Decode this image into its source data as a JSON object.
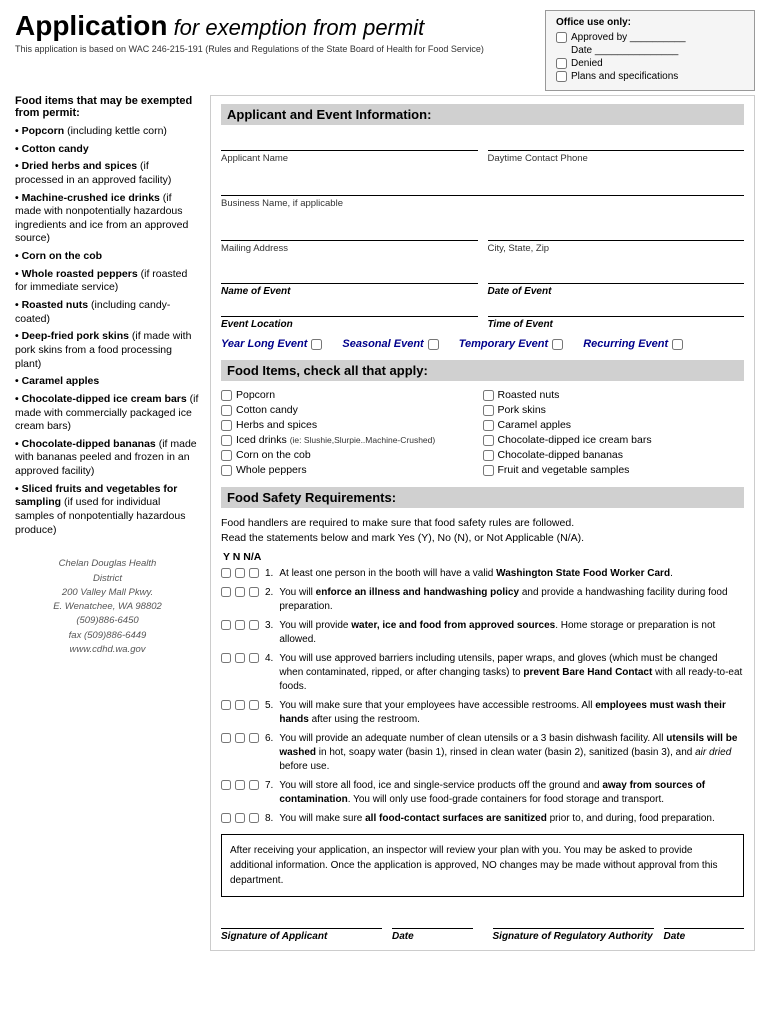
{
  "header": {
    "title_bold": "Application",
    "title_italic": " for exemption from permit",
    "subtitle": "This application is based on WAC 246-215-191 (Rules and Regulations of the State Board of Health for Food Service)"
  },
  "office_box": {
    "title": "Office use only:",
    "approved_by": "Approved by __________",
    "date": "Date _______________",
    "denied": "Denied",
    "plans": "Plans and specifications"
  },
  "sidebar": {
    "title": "Food items that may be exempted from permit:",
    "items": [
      {
        "bold": "Popcorn",
        "rest": " (including kettle corn)"
      },
      {
        "bold": "Cotton candy",
        "rest": ""
      },
      {
        "bold": "Dried herbs and spices",
        "rest": " (if processed in an approved facility)"
      },
      {
        "bold": "Machine-crushed ice drinks",
        "rest": " (if made with nonpotentially hazardous ingredients and ice from an approved source)"
      },
      {
        "bold": "Corn on the cob",
        "rest": ""
      },
      {
        "bold": "Whole roasted peppers",
        "rest": " (if roasted for immediate service)"
      },
      {
        "bold": "Roasted nuts",
        "rest": " (including candy-coated)"
      },
      {
        "bold": "Deep-fried pork skins",
        "rest": " (if made with pork skins from a food processing plant)"
      },
      {
        "bold": "Caramel apples",
        "rest": ""
      },
      {
        "bold": "Chocolate-dipped ice cream bars",
        "rest": " (if made with commercially packaged ice cream bars)"
      },
      {
        "bold": "Chocolate-dipped bananas",
        "rest": " (if made with bananas peeled and frozen in an approved facility)"
      },
      {
        "bold": "Sliced fruits and vegetables for sampling",
        "rest": " (if used for individual samples of nonpotentially hazardous produce)"
      }
    ],
    "footer_lines": [
      "Chelan Douglas Health",
      "District",
      "200 Valley Mall Pkwy.",
      "E. Wenatchee, WA 98802",
      "(509)886-6450",
      "fax (509)886-6449",
      "www.cdhd.wa.gov"
    ]
  },
  "applicant_section": {
    "title": "Applicant and Event Information:",
    "fields": {
      "applicant_name_label": "Applicant Name",
      "daytime_phone_label": "Daytime Contact Phone",
      "business_name_label": "Business Name, if applicable",
      "mailing_address_label": "Mailing Address",
      "city_state_zip_label": "City, State, Zip",
      "name_of_event_label": "Name of Event",
      "date_of_event_label": "Date of Event",
      "event_location_label": "Event Location",
      "time_of_event_label": "Time of Event"
    },
    "event_types": [
      "Year Long Event",
      "Seasonal Event",
      "Temporary Event",
      "Recurring Event"
    ]
  },
  "food_items": {
    "title": "Food Items, check all that apply:",
    "left_column": [
      "Popcorn",
      "Cotton candy",
      "Herbs and spices",
      "Iced drinks (ie: Slushie,Slurpie..Machine-Crushed)",
      "Corn on the cob",
      "Whole peppers"
    ],
    "right_column": [
      "Roasted nuts",
      "Pork skins",
      "Caramel apples",
      "Chocolate-dipped ice cream bars",
      "Chocolate-dipped bananas",
      "Fruit and vegetable samples"
    ]
  },
  "food_safety": {
    "title": "Food Safety Requirements:",
    "intro1": "Food handlers are required to make sure that food safety rules are followed.",
    "intro2": "Read the statements below and mark Yes (Y), No (N), or Not Applicable (N/A).",
    "yna_header": "Y  N  N/A",
    "items": [
      {
        "num": "1.",
        "text": "At least one person in the booth will have a valid ",
        "bold": "Washington State Food Worker Card",
        "text2": "."
      },
      {
        "num": "2.",
        "text": "You will ",
        "bold": "enforce an illness and handwashing policy",
        "text2": " and provide a handwashing facility during food preparation."
      },
      {
        "num": "3.",
        "text": "You will provide ",
        "bold": "water, ice and food from approved sources",
        "text2": ".  Home storage or preparation is not allowed."
      },
      {
        "num": "4.",
        "text": "You will use approved barriers including utensils, paper wraps, and gloves (which must be changed when contaminated, ripped, or after changing tasks) to ",
        "bold": "prevent Bare Hand Contact",
        "text2": " with all ready-to-eat foods."
      },
      {
        "num": "5.",
        "text": "You will make sure that your employees have accessible restrooms.  All ",
        "bold": "employees must wash their hands",
        "text2": " after using the restroom."
      },
      {
        "num": "6.",
        "text": "You will provide an adequate number of clean utensils or a 3 basin dishwash facility.  All ",
        "bold": "utensils will be washed",
        "text2": " in hot, soapy water (basin 1), rinsed in clean water (basin 2), sanitized (basin 3), and ",
        "italic": "air dried",
        "text3": " before use."
      },
      {
        "num": "7.",
        "text": "You will store all food, ice and single-service products off the ground and ",
        "bold": "away from sources of contamination",
        "text2": ".  You will only use food-grade containers for food storage and transport."
      },
      {
        "num": "8.",
        "text": "You will make sure ",
        "bold": "all food-contact surfaces are sanitized",
        "text2": " prior to, and during, food preparation."
      }
    ]
  },
  "notice": {
    "text": "After receiving your application, an inspector will review your plan with you.  You may be asked to provide additional information.  Once the application is approved, NO changes may be made without approval from this department."
  },
  "signatures": {
    "applicant_label": "Signature of Applicant",
    "date1_label": "Date",
    "authority_label": "Signature of Regulatory Authority",
    "date2_label": "Date"
  }
}
